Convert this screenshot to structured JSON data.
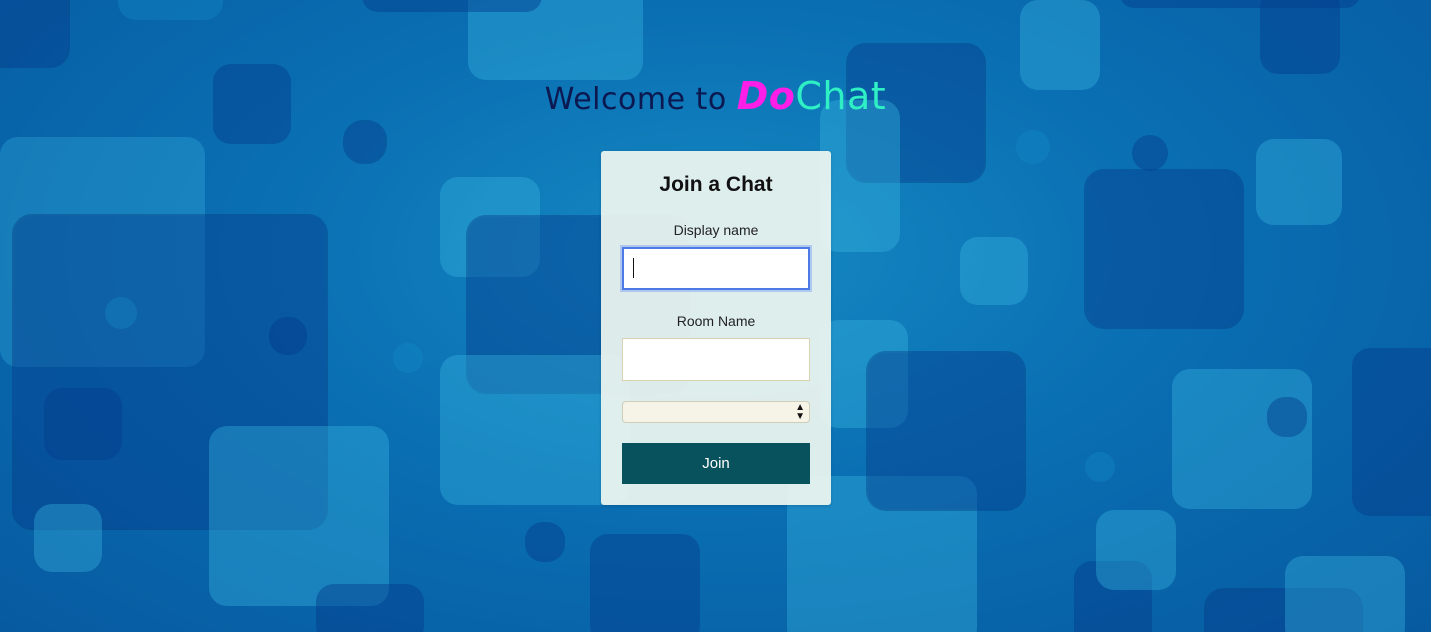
{
  "header": {
    "welcome_text": "Welcome to ",
    "brand_part1": "Do",
    "brand_part2": "Chat"
  },
  "form": {
    "title": "Join a Chat",
    "display_name_label": "Display name",
    "display_name_value": "",
    "room_name_label": "Room Name",
    "room_name_value": "",
    "room_select_value": "",
    "join_label": "Join"
  },
  "colors": {
    "brand_do": "#ff1ee8",
    "brand_chat": "#2ef0c4",
    "join_button": "#08525e",
    "focus_ring": "#4c7be8"
  }
}
